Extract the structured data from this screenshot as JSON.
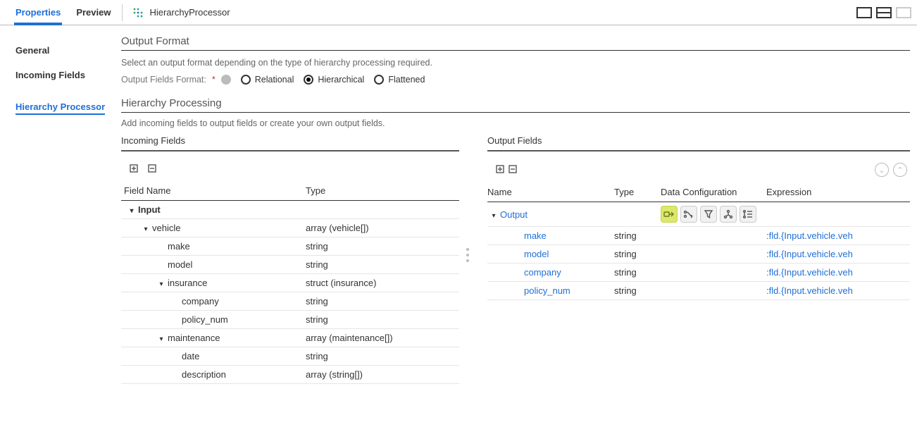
{
  "tabs": {
    "properties": "Properties",
    "preview": "Preview"
  },
  "processor_name": "HierarchyProcessor",
  "leftnav": {
    "general": "General",
    "incoming": "Incoming Fields",
    "hierarchy": "Hierarchy Processor"
  },
  "output_format": {
    "title": "Output Format",
    "helper": "Select an output format depending on the type of hierarchy processing required.",
    "label": "Output Fields Format:",
    "options": {
      "relational": "Relational",
      "hierarchical": "Hierarchical",
      "flattened": "Flattened"
    }
  },
  "processing": {
    "title": "Hierarchy Processing",
    "helper": "Add incoming fields to output fields or create your own output fields."
  },
  "incoming": {
    "title": "Incoming Fields",
    "cols": {
      "name": "Field Name",
      "type": "Type"
    },
    "rows": [
      {
        "name": "Input",
        "type": "",
        "indent": 0,
        "chev": true,
        "root": true
      },
      {
        "name": "vehicle",
        "type": "array (vehicle[])",
        "indent": 1,
        "chev": true
      },
      {
        "name": "make",
        "type": "string",
        "indent": 2
      },
      {
        "name": "model",
        "type": "string",
        "indent": 2
      },
      {
        "name": "insurance",
        "type": "struct (insurance)",
        "indent": 2,
        "chev": true
      },
      {
        "name": "company",
        "type": "string",
        "indent": 3
      },
      {
        "name": "policy_num",
        "type": "string",
        "indent": 3
      },
      {
        "name": "maintenance",
        "type": "array (maintenance[])",
        "indent": 2,
        "chev": true
      },
      {
        "name": "date",
        "type": "string",
        "indent": 3
      },
      {
        "name": "description",
        "type": "array (string[])",
        "indent": 3
      }
    ]
  },
  "output": {
    "title": "Output Fields",
    "cols": {
      "name": "Name",
      "type": "Type",
      "conf": "Data Configuration",
      "expr": "Expression"
    },
    "rows": [
      {
        "name": "Output",
        "type": "",
        "expr": "",
        "indent": 0,
        "chev": true,
        "conf": true,
        "link": true
      },
      {
        "name": "make",
        "type": "string",
        "expr": ":fld.{Input.vehicle.veh",
        "indent": 1,
        "link": true
      },
      {
        "name": "model",
        "type": "string",
        "expr": ":fld.{Input.vehicle.veh",
        "indent": 1,
        "link": true
      },
      {
        "name": "company",
        "type": "string",
        "expr": ":fld.{Input.vehicle.veh",
        "indent": 1,
        "link": true
      },
      {
        "name": "policy_num",
        "type": "string",
        "expr": ":fld.{Input.vehicle.veh",
        "indent": 1,
        "link": true
      }
    ]
  }
}
